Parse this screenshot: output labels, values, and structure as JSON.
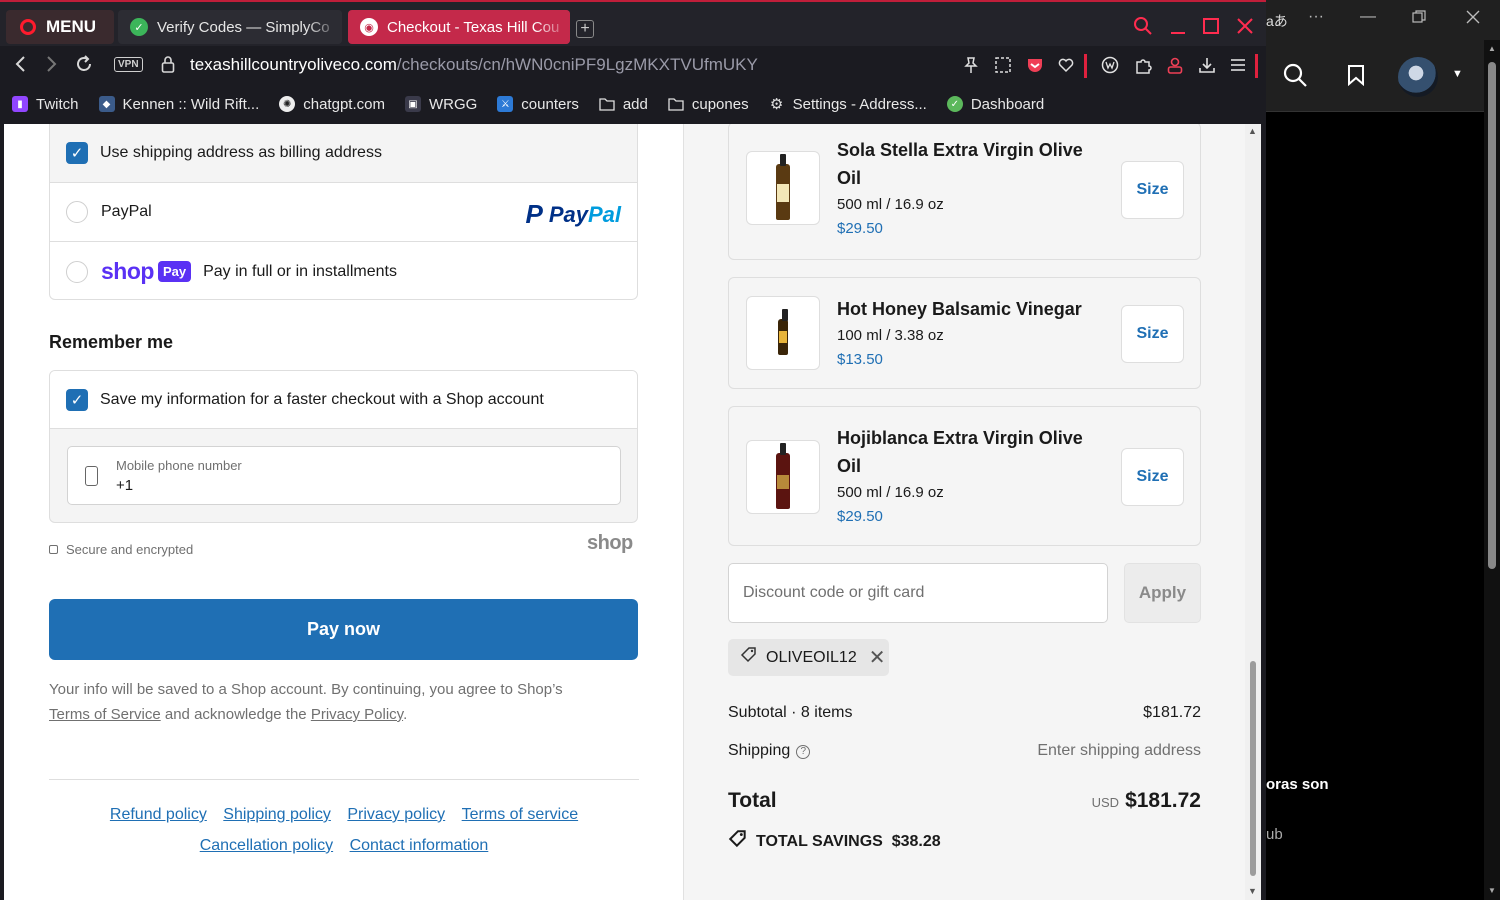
{
  "browser": {
    "menu_label": "MENU",
    "tabs": [
      {
        "title": "Verify Codes — SimplyCo"
      },
      {
        "title": "Checkout - Texas Hill Cou"
      }
    ],
    "url_host": "texashillcountryoliveco.com",
    "url_path": "/checkouts/cn/hWN0cniPF9LgzMKXTVUfmUKY",
    "vpn_label": "VPN",
    "bookmarks": [
      {
        "label": "Twitch",
        "color": "#9146ff"
      },
      {
        "label": "Kennen :: Wild Rift...",
        "color": "#3b5b8a"
      },
      {
        "label": "chatgpt.com",
        "color": "#444444"
      },
      {
        "label": "WRGG",
        "color": "#3a3a4a"
      },
      {
        "label": "counters",
        "color": "#2d7ad6"
      },
      {
        "label": "add",
        "color": "folder"
      },
      {
        "label": "cupones",
        "color": "folder"
      },
      {
        "label": "Settings - Address...",
        "color": "gear"
      },
      {
        "label": "Dashboard",
        "color": "#5cb85c"
      }
    ]
  },
  "checkout": {
    "billing_checkbox_label": "Use shipping address as billing address",
    "paypal_label": "PayPal",
    "paypal_logo_a": "Pay",
    "paypal_logo_b": "Pal",
    "shoppay_word": "shop",
    "shoppay_badge": "Pay",
    "shoppay_label": "Pay in full or in installments",
    "remember_title": "Remember me",
    "save_info_label": "Save my information for a faster checkout with a Shop account",
    "phone_label": "Mobile phone number",
    "phone_value": "+1",
    "secure_label": "Secure and encrypted",
    "shop_mark": "shop",
    "pay_now_label": "Pay now",
    "consent_text_1": "Your info will be saved to a Shop account. By continuing, you agree to Shop’s",
    "consent_terms_link": "Terms of Service",
    "consent_text_2": "and acknowledge the",
    "consent_privacy_link": "Privacy Policy",
    "consent_text_3": ".",
    "footer_links": [
      "Refund policy",
      "Shipping policy",
      "Privacy policy",
      "Terms of service",
      "Cancellation policy",
      "Contact information"
    ]
  },
  "order": {
    "items": [
      {
        "name": "Sola Stella Extra Virgin Olive Oil",
        "size": "500 ml / 16.9 oz",
        "price": "$29.50",
        "button": "Size"
      },
      {
        "name": "Hot Honey Balsamic Vinegar",
        "size": "100 ml / 3.38 oz",
        "price": "$13.50",
        "button": "Size"
      },
      {
        "name": "Hojiblanca Extra Virgin Olive Oil",
        "size": "500 ml / 16.9 oz",
        "price": "$29.50",
        "button": "Size"
      }
    ],
    "discount_placeholder": "Discount code or gift card",
    "apply_label": "Apply",
    "coupon_code": "OLIVEOIL12",
    "subtotal_label": "Subtotal · 8 items",
    "subtotal_value": "$181.72",
    "shipping_label": "Shipping",
    "shipping_value": "Enter shipping address",
    "total_label": "Total",
    "total_currency": "USD",
    "total_value": "$181.72",
    "savings_label": "TOTAL SAVINGS",
    "savings_value": "$38.28"
  },
  "background_window": {
    "lang_glyph": "aあ",
    "text_1": "oras son",
    "text_2": "ub"
  }
}
